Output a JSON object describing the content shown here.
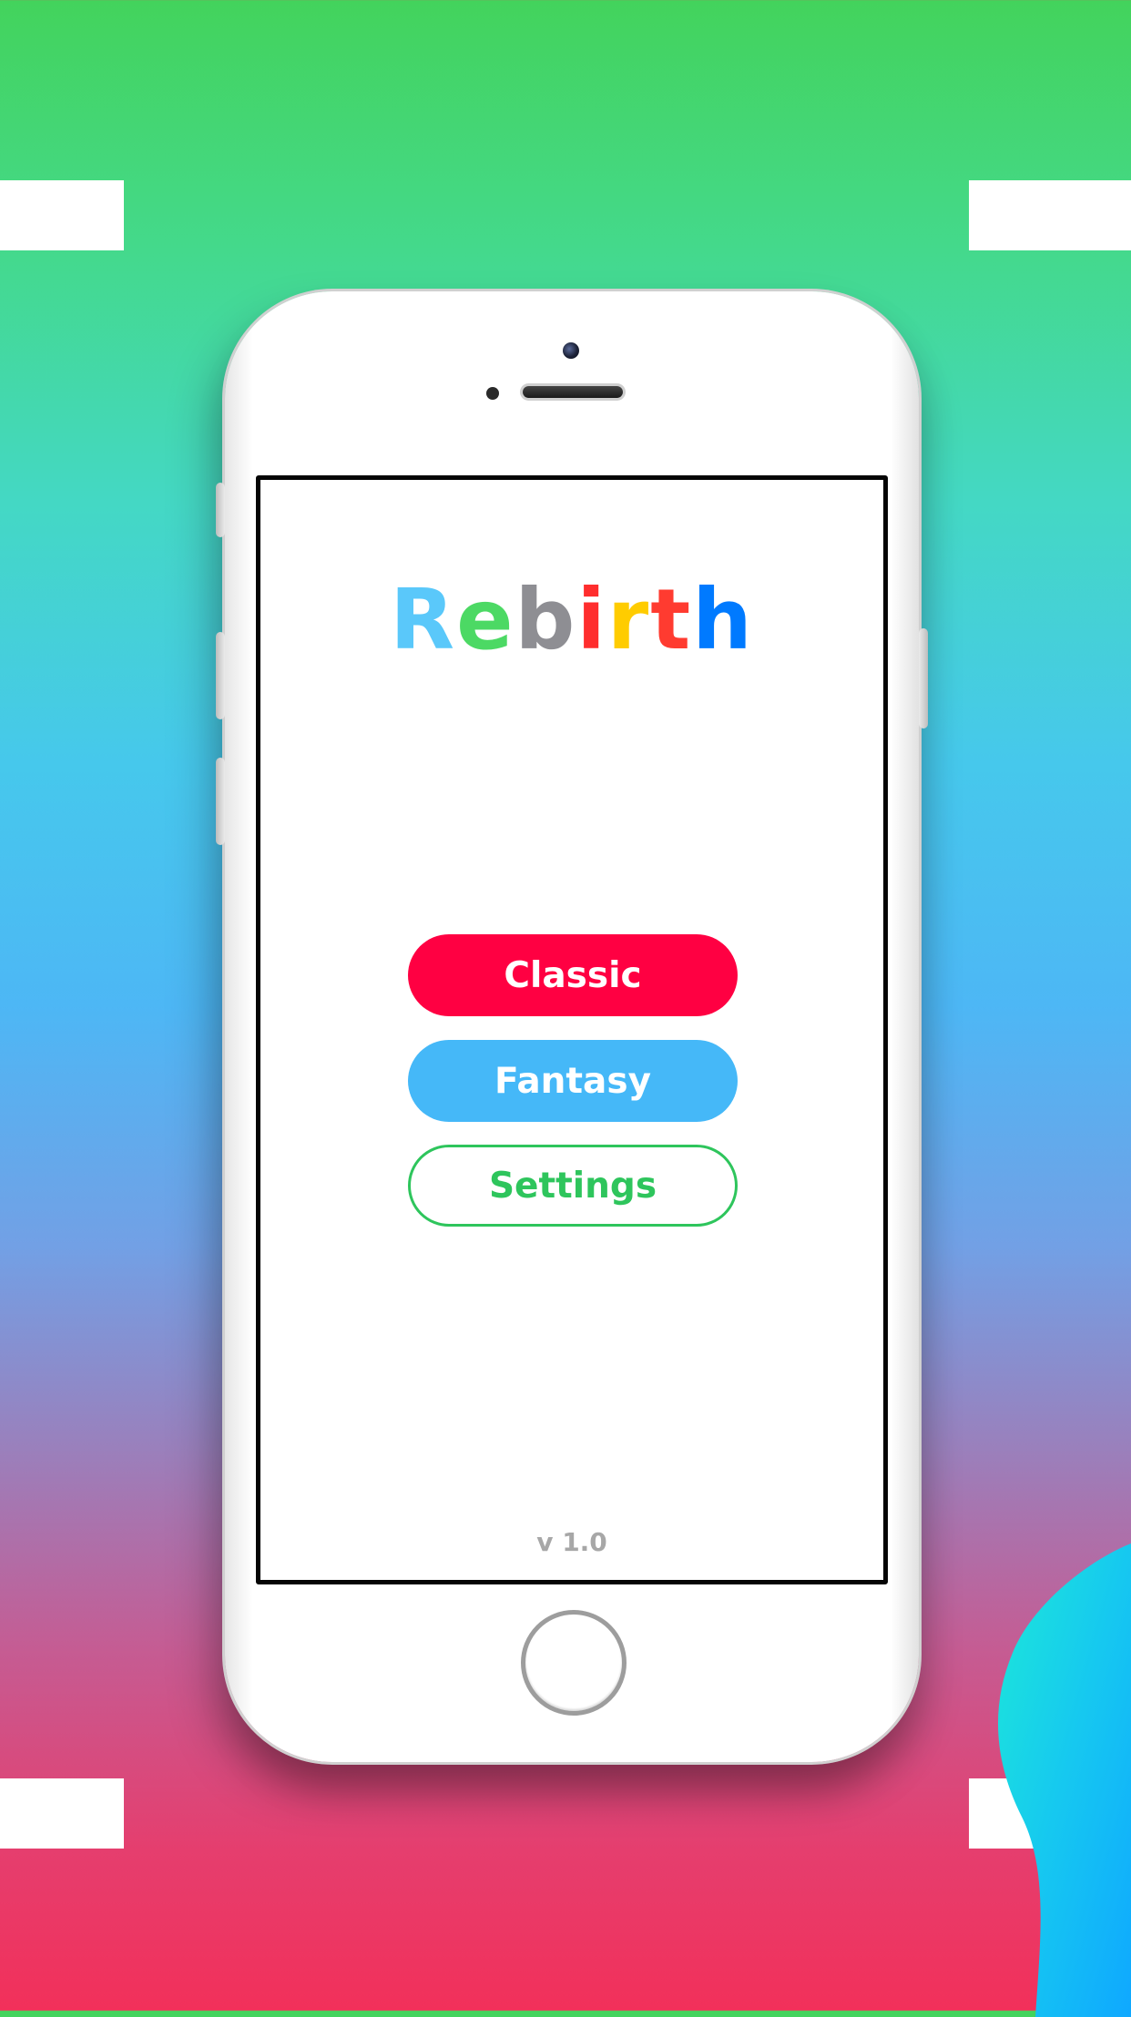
{
  "app": {
    "title_letters": [
      {
        "char": "R",
        "color": "#5ac8fa"
      },
      {
        "char": "e",
        "color": "#4cd964"
      },
      {
        "char": "b",
        "color": "#8e8e93"
      },
      {
        "char": "i",
        "color": "#ff2d2d"
      },
      {
        "char": "r",
        "color": "#ffcc00"
      },
      {
        "char": "t",
        "color": "#ff3b30"
      },
      {
        "char": "h",
        "color": "#007aff"
      }
    ],
    "version": "v 1.0"
  },
  "menu": {
    "classic_label": "Classic",
    "fantasy_label": "Fantasy",
    "settings_label": "Settings"
  },
  "colors": {
    "classic": "#ff0042",
    "fantasy": "#45b8f8",
    "settings": "#2ec55c"
  },
  "device": {
    "icons": [
      "camera-icon",
      "proximity-sensor-icon",
      "earpiece-speaker-icon",
      "home-button-icon"
    ]
  }
}
